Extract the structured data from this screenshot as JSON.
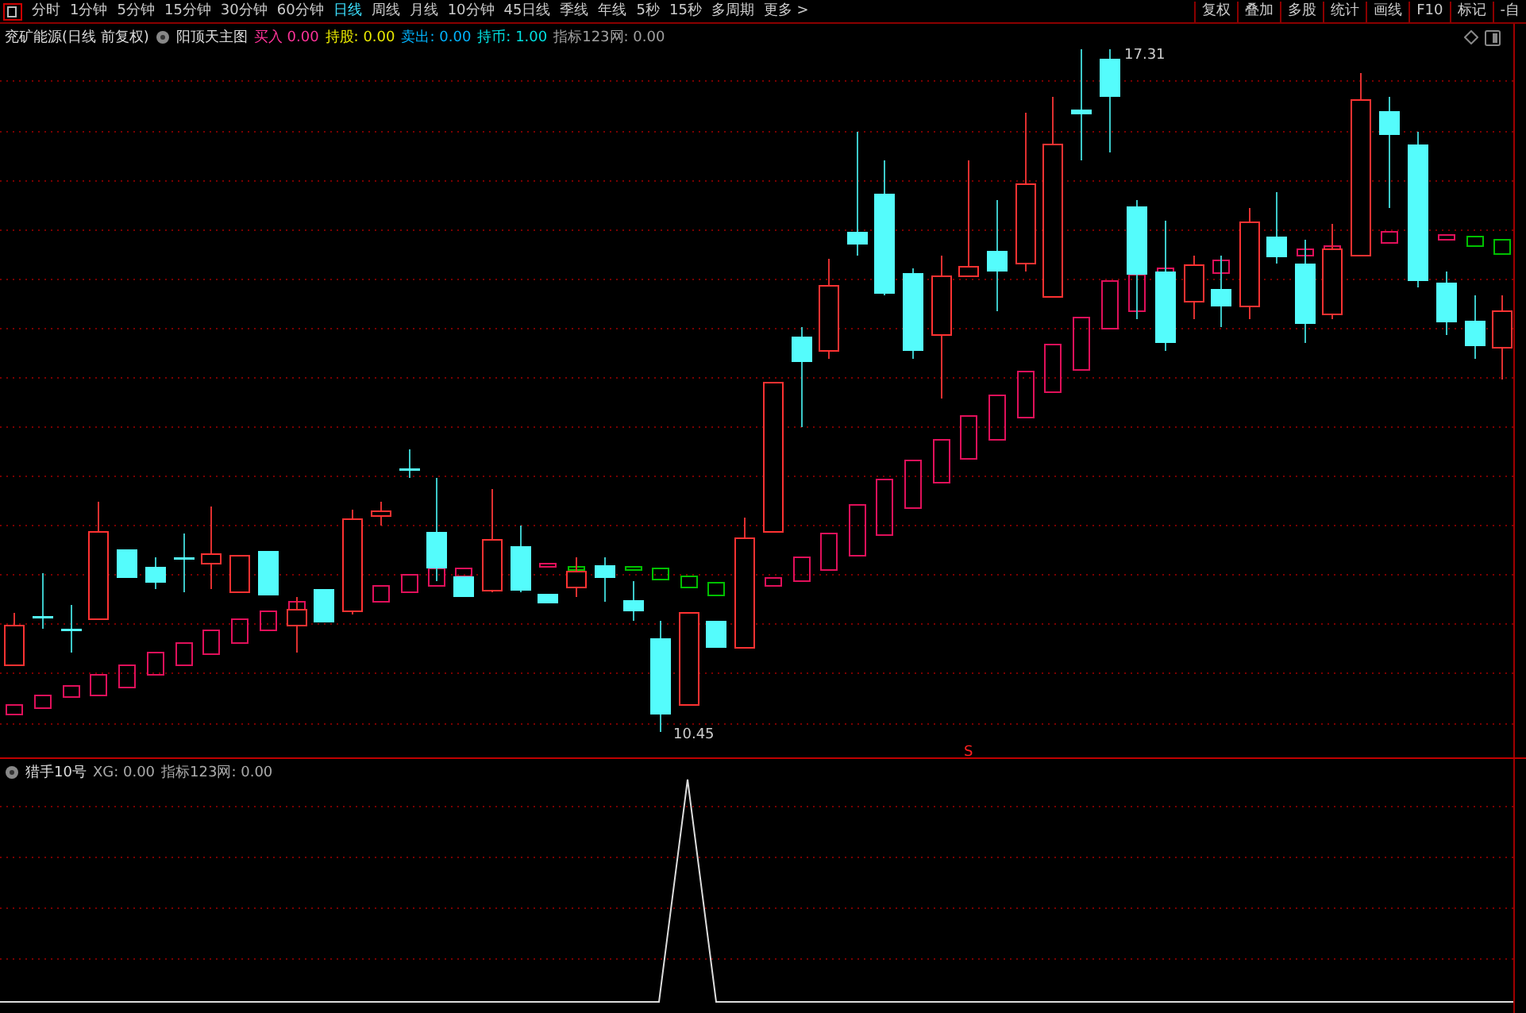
{
  "period_tabs": [
    {
      "label": "分时",
      "selected": false
    },
    {
      "label": "1分钟",
      "selected": false
    },
    {
      "label": "5分钟",
      "selected": false
    },
    {
      "label": "15分钟",
      "selected": false
    },
    {
      "label": "30分钟",
      "selected": false
    },
    {
      "label": "60分钟",
      "selected": false
    },
    {
      "label": "日线",
      "selected": true
    },
    {
      "label": "周线",
      "selected": false
    },
    {
      "label": "月线",
      "selected": false
    },
    {
      "label": "10分钟",
      "selected": false
    },
    {
      "label": "45日线",
      "selected": false
    },
    {
      "label": "季线",
      "selected": false
    },
    {
      "label": "年线",
      "selected": false
    },
    {
      "label": "5秒",
      "selected": false
    },
    {
      "label": "15秒",
      "selected": false
    },
    {
      "label": "多周期",
      "selected": false
    },
    {
      "label": "更多 >",
      "selected": false
    }
  ],
  "toolbar_buttons": [
    "复权",
    "叠加",
    "多股",
    "统计",
    "画线",
    "F10",
    "标记",
    "-自"
  ],
  "main_chart": {
    "stock_title": "兖矿能源(日线 前复权)",
    "indicator_name": "阳顶天主图",
    "values": [
      {
        "label": "买入",
        "value": "0.00",
        "color": "#ff3399"
      },
      {
        "label": "持股:",
        "value": "0.00",
        "color": "#e8e800"
      },
      {
        "label": "卖出:",
        "value": "0.00",
        "color": "#00b4ff"
      },
      {
        "label": "持币:",
        "value": "1.00",
        "color": "#00e0e0"
      },
      {
        "label": "指标123网:",
        "value": "0.00",
        "color": "#a0a0a0"
      }
    ],
    "high_label": "17.31",
    "low_label": "10.45",
    "signal_label": "S"
  },
  "sub_chart": {
    "indicator_name": "猎手10号",
    "values": [
      {
        "label": "XG:",
        "value": "0.00"
      },
      {
        "label": "指标123网:",
        "value": "0.00"
      }
    ]
  }
}
